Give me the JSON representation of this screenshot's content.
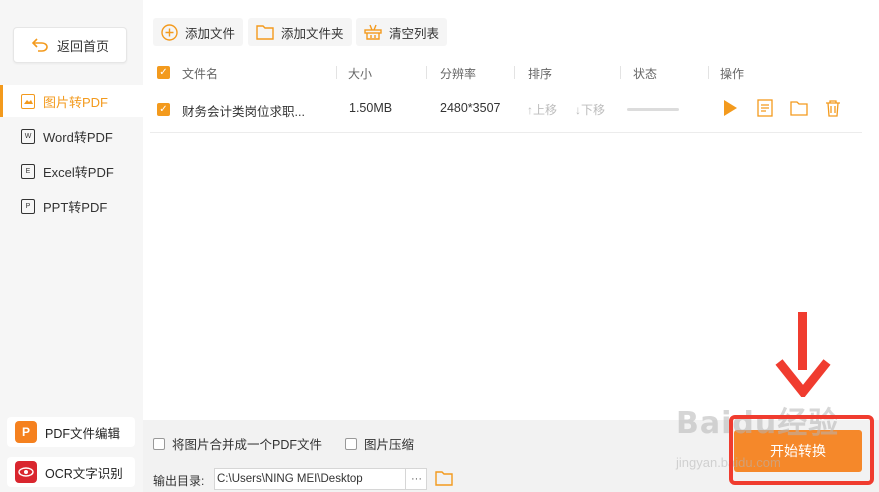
{
  "sidebar": {
    "back_label": "返回首页",
    "items": [
      {
        "label": "图片转PDF",
        "icon": "image-icon",
        "active": true
      },
      {
        "label": "Word转PDF",
        "icon": "word-doc-icon",
        "active": false
      },
      {
        "label": "Excel转PDF",
        "icon": "excel-doc-icon",
        "active": false
      },
      {
        "label": "PPT转PDF",
        "icon": "ppt-doc-icon",
        "active": false
      }
    ],
    "tools": [
      {
        "label": "PDF文件编辑",
        "icon": "pdf-edit-logo",
        "color": "#f5811f"
      },
      {
        "label": "OCR文字识别",
        "icon": "ocr-eye-logo",
        "color": "#d9262e"
      }
    ]
  },
  "toolbar": {
    "add_file": "添加文件",
    "add_folder": "添加文件夹",
    "clear_list": "清空列表"
  },
  "table": {
    "headers": [
      "文件名",
      "大小",
      "分辨率",
      "排序",
      "状态",
      "操作"
    ],
    "rows": [
      {
        "name": "财务会计类岗位求职...",
        "size": "1.50MB",
        "resolution": "2480*3507",
        "move_up": "上移",
        "move_down": "下移"
      }
    ]
  },
  "bottom": {
    "merge_option": "将图片合并成一个PDF文件",
    "compress_option": "图片压缩",
    "output_label": "输出目录:",
    "output_path": "C:\\Users\\NING MEI\\Desktop",
    "more": "···",
    "start_button": "开始转换"
  },
  "watermark": {
    "brand": "Baidu经验",
    "url": "jingyan.baidu.com"
  },
  "colors": {
    "accent": "#f39a1d",
    "start": "#f5882a",
    "highlight": "#f03c2f"
  }
}
